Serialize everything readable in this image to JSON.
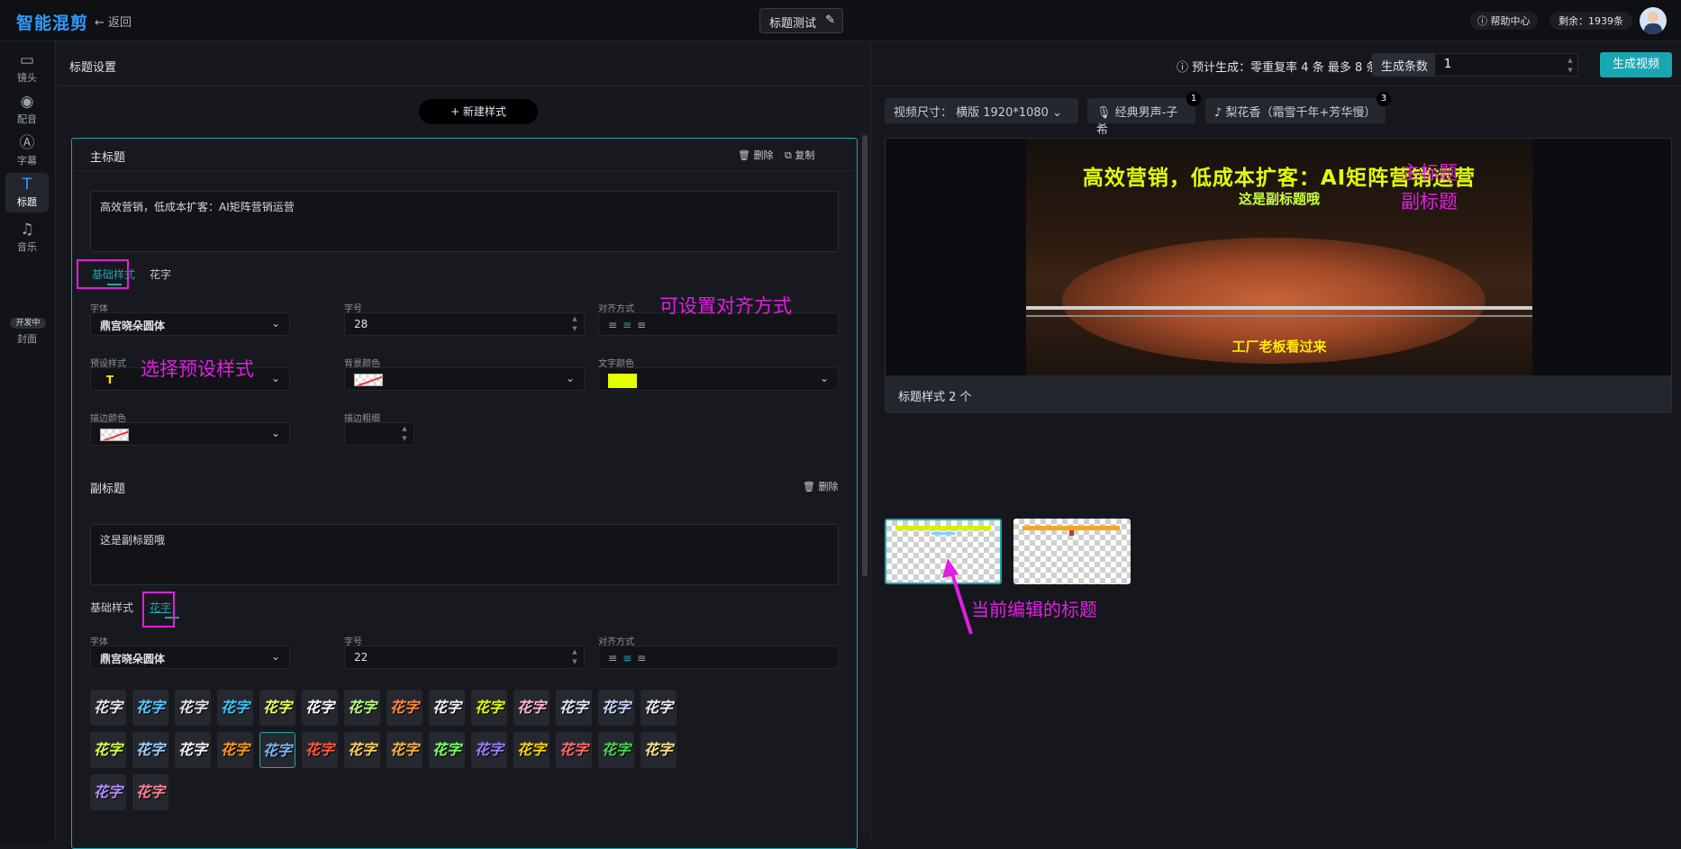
{
  "app": {
    "title": "智能混剪",
    "back": "返回",
    "project_name": "标题测试",
    "help": "帮助中心",
    "remaining": "剩余：1939条"
  },
  "sidebar": {
    "items": [
      {
        "label": "镜头",
        "icon": "camera-icon"
      },
      {
        "label": "配音",
        "icon": "voice-icon"
      },
      {
        "label": "字幕",
        "icon": "subtitle-icon"
      },
      {
        "label": "标题",
        "icon": "title-icon"
      },
      {
        "label": "音乐",
        "icon": "music-icon"
      },
      {
        "label": "封面",
        "icon": "cover-icon"
      }
    ],
    "dev_badge": "开发中"
  },
  "left": {
    "panel_title": "标题设置",
    "new_style": "+ 新建样式",
    "main": {
      "title": "主标题",
      "delete": "删除",
      "copy": "复制",
      "text": "高效营销，低成本扩客：AI矩阵营销运营",
      "tabs": [
        "基础样式",
        "花字"
      ],
      "font_label": "字体",
      "font_value": "鼎宫晓朵圆体",
      "size_label": "字号",
      "size_value": "28",
      "align_label": "对齐方式",
      "preset_label": "预设样式",
      "preset_value": "T",
      "bg_label": "背景颜色",
      "text_color_label": "文字颜色",
      "text_color": "#e4ff00",
      "stroke_color_label": "描边颜色",
      "stroke_width_label": "描边粗细"
    },
    "sub": {
      "title": "副标题",
      "delete": "删除",
      "text": "这是副标题哦",
      "tabs": [
        "基础样式",
        "花字"
      ],
      "font_label": "字体",
      "font_value": "鼎宫晓朵圆体",
      "size_label": "字号",
      "size_value": "22",
      "align_label": "对齐方式",
      "fancy_label": "花字",
      "fancy_count": 30
    },
    "annotations": {
      "align": "可设置对齐方式",
      "preset": "选择预设样式"
    }
  },
  "right": {
    "estimate": "预计生成：零重复率 4 条 最多 8 条",
    "count_label": "生成条数",
    "count_value": "1",
    "generate": "生成视频",
    "size_opt": "视频尺寸：  横版 1920*1080",
    "voice_opt": "经典男声-子希",
    "voice_num": "1",
    "music_opt": "梨花香（霜雪千年+芳华慢）",
    "music_num": "3",
    "video_main": "高效营销，低成本扩客：AI矩阵营销运营",
    "video_sub": "这是副标题哦",
    "video_bottom": "工厂老板看过来",
    "annot_main": "主标题",
    "annot_sub": "副标题",
    "style_count": "标题样式 2 个",
    "annot_current": "当前编辑的标题"
  },
  "colors": {
    "accent": "#1aa6b1",
    "annotation": "#e01fe0",
    "title_yellow": "#e4ff00"
  }
}
